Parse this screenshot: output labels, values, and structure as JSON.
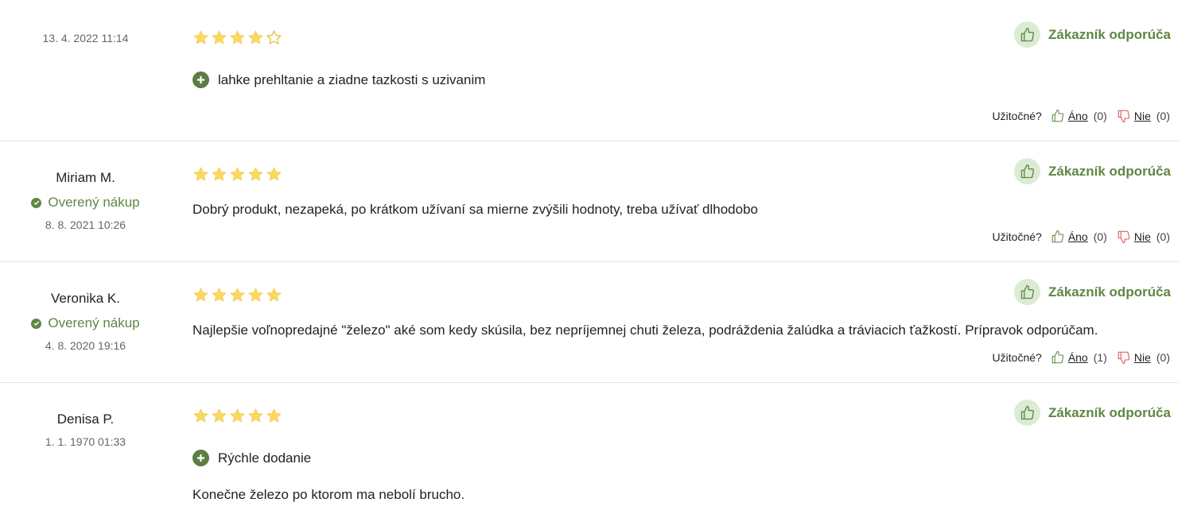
{
  "colors": {
    "accent_green": "#5f8745",
    "recommend_bg": "#dcebd4",
    "star_fill": "#fbd961",
    "thumb_down_red": "#d9534f"
  },
  "icons": {
    "star": "star-icon",
    "thumb_up": "thumb-up-icon",
    "thumb_down": "thumb-down-icon",
    "plus": "plus-icon",
    "check": "check-icon"
  },
  "reviews": [
    {
      "author": "",
      "verified": "",
      "date": "13. 4. 2022 11:14",
      "rating": 4,
      "recommend": "Zákazník odporúča",
      "pro": "lahke prehltanie a ziadne tazkosti s uzivanim",
      "text": "",
      "useful_label": "Užitočné?",
      "yes_label": "Áno",
      "yes_count": "(0)",
      "no_label": "Nie",
      "no_count": "(0)"
    },
    {
      "author": "Miriam M.",
      "verified": "Overený nákup",
      "date": "8. 8. 2021 10:26",
      "rating": 5,
      "recommend": "Zákazník odporúča",
      "pro": "",
      "text": "Dobrý produkt, nezapeká, po krátkom užívaní sa mierne zvýšili hodnoty, treba užívať dlhodobo",
      "useful_label": "Užitočné?",
      "yes_label": "Áno",
      "yes_count": "(0)",
      "no_label": "Nie",
      "no_count": "(0)"
    },
    {
      "author": "Veronika K.",
      "verified": "Overený nákup",
      "date": "4. 8. 2020 19:16",
      "rating": 5,
      "recommend": "Zákazník odporúča",
      "pro": "",
      "text": "Najlepšie voľnopredajné \"železo\" aké som kedy skúsila, bez nepríjemnej chuti železa, podráždenia žalúdka a tráviacich ťažkostí. Prípravok odporúčam.",
      "useful_label": "Užitočné?",
      "yes_label": "Áno",
      "yes_count": "(1)",
      "no_label": "Nie",
      "no_count": "(0)"
    },
    {
      "author": "Denisa P.",
      "verified": "",
      "date": "1. 1. 1970 01:33",
      "rating": 5,
      "recommend": "Zákazník odporúča",
      "pro": "Rýchle dodanie",
      "text": "Konečne železo po ktorom ma nebolí brucho.",
      "useful_label": "",
      "yes_label": "",
      "yes_count": "",
      "no_label": "",
      "no_count": ""
    }
  ]
}
